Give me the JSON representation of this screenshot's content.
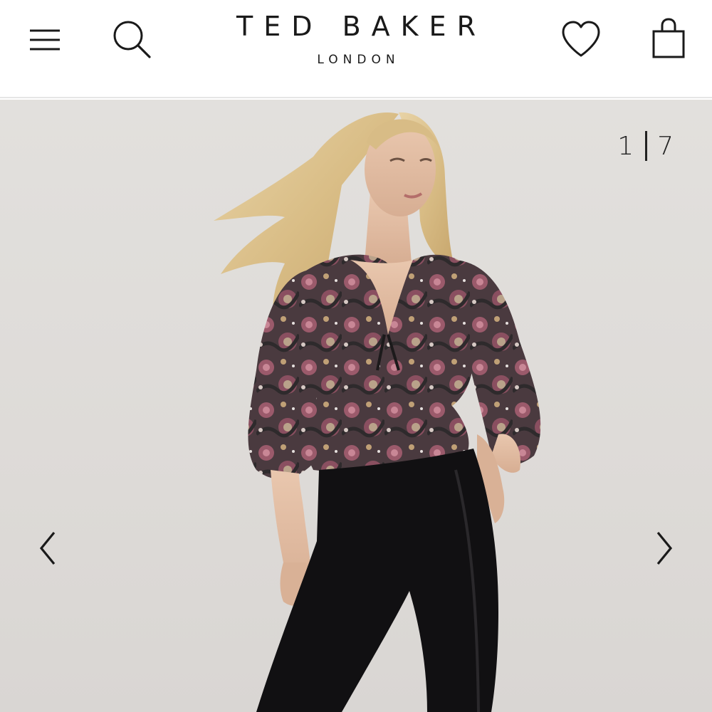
{
  "header": {
    "brand_name": "TED BAKER",
    "brand_sub": "LONDON",
    "icons": {
      "menu": "hamburger-menu-icon",
      "search": "search-icon",
      "wishlist": "heart-icon",
      "bag": "shopping-bag-icon"
    }
  },
  "gallery": {
    "current": "1",
    "total": "7",
    "icons": {
      "prev": "chevron-left-icon",
      "next": "chevron-right-icon"
    }
  },
  "colors": {
    "text": "#1a1a1a",
    "gallery_bg": "#dedbd8"
  }
}
